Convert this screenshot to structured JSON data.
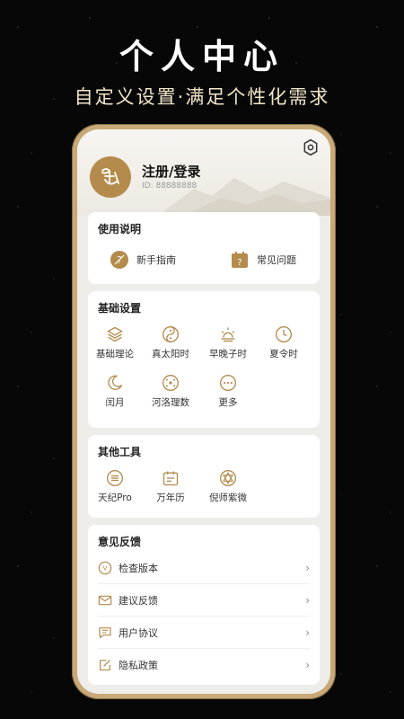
{
  "promo": {
    "title": "个人中心",
    "subtitle": "自定义设置·满足个性化需求"
  },
  "profile": {
    "login_label": "注册/登录",
    "id_text": "ID: 88888888"
  },
  "usage": {
    "title": "使用说明",
    "items": [
      {
        "label": "新手指南",
        "icon": "guide-icon"
      },
      {
        "label": "常见问题",
        "icon": "faq-icon"
      }
    ]
  },
  "basic_settings": {
    "title": "基础设置",
    "items": [
      {
        "label": "基础理论",
        "icon": "layers-icon"
      },
      {
        "label": "真太阳时",
        "icon": "yin-yang-icon"
      },
      {
        "label": "早晚子时",
        "icon": "sunrise-icon"
      },
      {
        "label": "夏令时",
        "icon": "clock-icon"
      },
      {
        "label": "闰月",
        "icon": "moon-icon"
      },
      {
        "label": "河洛理数",
        "icon": "hetu-icon"
      },
      {
        "label": "更多",
        "icon": "more-icon"
      }
    ]
  },
  "other_tools": {
    "title": "其他工具",
    "items": [
      {
        "label": "天纪Pro",
        "icon": "tianji-icon"
      },
      {
        "label": "万年历",
        "icon": "calendar-icon"
      },
      {
        "label": "倪师紫微",
        "icon": "star-icon"
      }
    ]
  },
  "feedback": {
    "title": "意见反馈",
    "items": [
      {
        "label": "检查版本",
        "icon": "version-icon"
      },
      {
        "label": "建议反馈",
        "icon": "mail-icon"
      },
      {
        "label": "用户协议",
        "icon": "agreement-icon"
      },
      {
        "label": "隐私政策",
        "icon": "privacy-icon"
      }
    ]
  },
  "colors": {
    "accent": "#b48b4d",
    "frame": "#c9a979"
  }
}
